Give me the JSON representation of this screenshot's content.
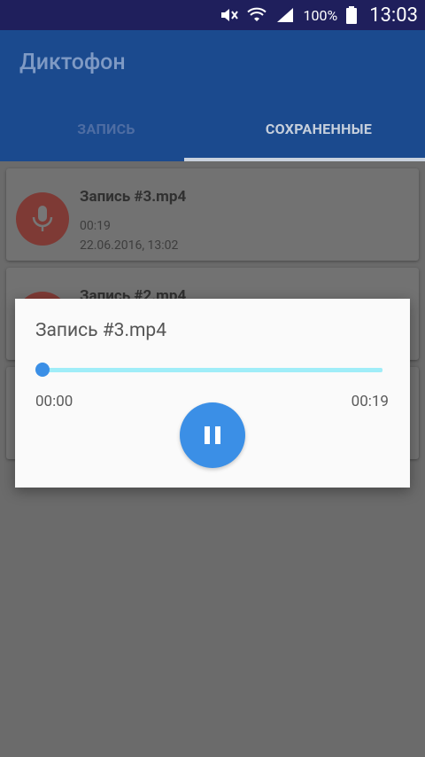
{
  "status_bar": {
    "battery_percent": "100%",
    "time": "13:03",
    "icons": [
      "mute-icon",
      "wifi-icon",
      "signal-icon",
      "battery-icon"
    ]
  },
  "app_bar": {
    "title": "Диктофон",
    "tabs": [
      {
        "label": "ЗАПИСЬ",
        "selected": false
      },
      {
        "label": "СОХРАНЕННЫЕ",
        "selected": true
      }
    ]
  },
  "recordings": [
    {
      "title": "Запись #3.mp4",
      "duration": "00:19",
      "date": "22.06.2016, 13:02"
    },
    {
      "title": "Запись #2.mp4",
      "duration": "",
      "date": ""
    },
    {
      "title": "",
      "duration": "",
      "date": ""
    }
  ],
  "player_dialog": {
    "title": "Запись #3.mp4",
    "current_time": "00:00",
    "total_time": "00:19",
    "progress": 0.0,
    "control": "pause-icon"
  },
  "colors": {
    "primary": "#2b6fd4",
    "accent": "#3b8fe6",
    "seek_track": "#a0edf8",
    "mic_red": "#d93b30"
  }
}
